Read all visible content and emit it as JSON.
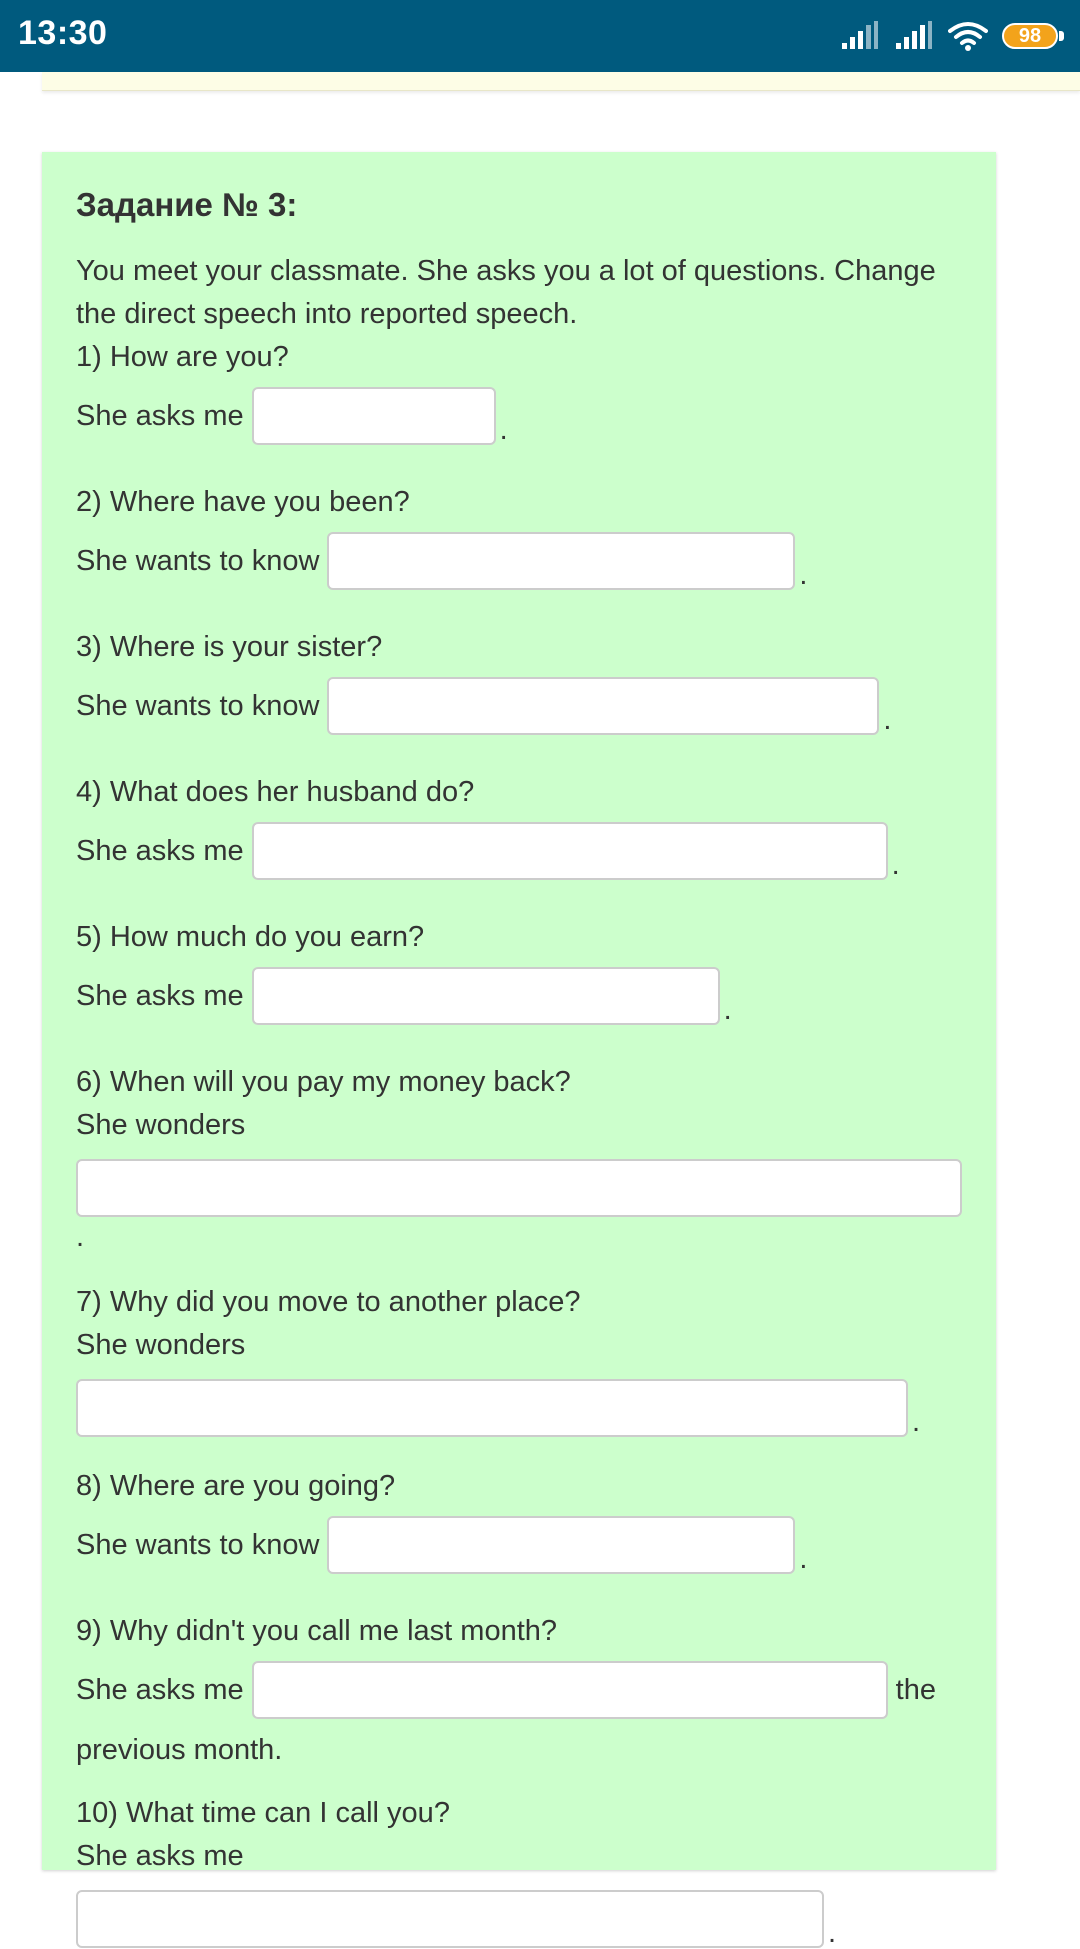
{
  "status_bar": {
    "time": "13:30",
    "battery": "98",
    "icons": [
      "signal-icon",
      "signal-icon",
      "wifi-icon",
      "battery-icon"
    ]
  },
  "task": {
    "title": "Задание № 3:",
    "intro": "You meet your classmate. She asks you a lot of questions. Change the direct speech into reported speech.",
    "questions": [
      {
        "text": "1) How are you?",
        "lead": "She asks me",
        "tail": "."
      },
      {
        "text": "2) Where have you been?",
        "lead": "She wants to know",
        "tail": "."
      },
      {
        "text": "3) Where is your sister?",
        "lead": "She wants to know",
        "tail": "."
      },
      {
        "text": "4) What does her husband do?",
        "lead": "She asks me",
        "tail": "."
      },
      {
        "text": "5) How much do you earn?",
        "lead": "She asks me",
        "tail": "."
      },
      {
        "text": "6) When will you pay my money back?",
        "lead": "She wonders",
        "tail": "."
      },
      {
        "text": "7) Why did you move to another place?",
        "lead": "She wonders",
        "tail": "."
      },
      {
        "text": "8) Where are you going?",
        "lead": "She wants to know",
        "tail": "."
      },
      {
        "text": "9) Why didn't you call me last month?",
        "lead": "She asks me",
        "tail": "the",
        "tail_wrap": "previous month."
      },
      {
        "text": "10) What time can I call you?",
        "lead": "She asks me",
        "tail": "."
      }
    ],
    "answers": [
      "",
      "",
      "",
      "",
      "",
      "",
      "",
      "",
      "",
      ""
    ]
  },
  "colors": {
    "status_bar": "#005a7e",
    "card_background": "#ccffcc",
    "battery": "#f3a31b",
    "text": "#333333"
  }
}
